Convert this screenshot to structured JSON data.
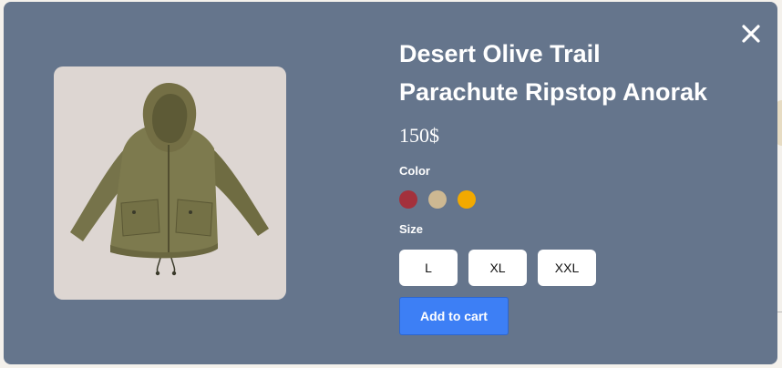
{
  "modal": {
    "close_icon": "close-icon",
    "image_alt": "jacket-image"
  },
  "product": {
    "title_line1": "Desert Olive Trail",
    "title_line2": "Parachute Ripstop Anorak",
    "price": "150$"
  },
  "color": {
    "label": "Color",
    "swatches": [
      {
        "name": "red",
        "hex": "#a3313c"
      },
      {
        "name": "tan",
        "hex": "#cdb892"
      },
      {
        "name": "gold",
        "hex": "#f2a900"
      }
    ]
  },
  "size": {
    "label": "Size",
    "options": [
      "L",
      "XL",
      "XXL"
    ]
  },
  "actions": {
    "add_to_cart": "Add to cart"
  },
  "colors": {
    "modal_bg": "#65758c",
    "image_bg": "#ddd6d2",
    "primary": "#3d7ff5",
    "jacket": "#7d7a4e"
  }
}
